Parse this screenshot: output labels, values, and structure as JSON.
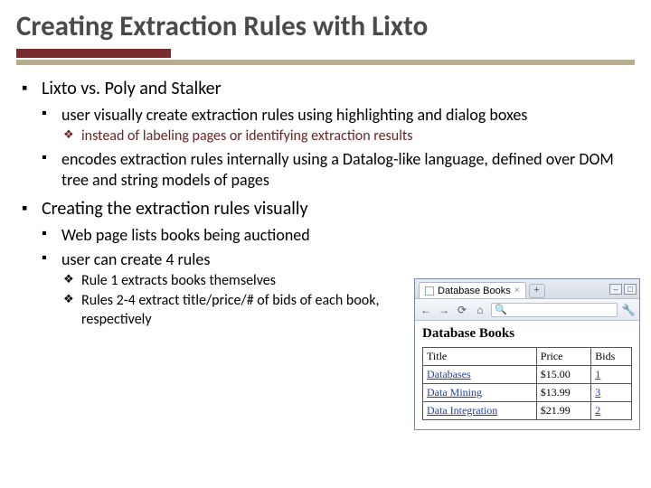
{
  "title": "Creating Extraction Rules with Lixto",
  "sections": [
    {
      "heading": "Lixto vs. Poly and Stalker",
      "items": [
        {
          "text": "user visually create extraction rules using highlighting and dialog boxes",
          "sub": [
            "instead of labeling pages or identifying extraction results"
          ],
          "sub_accent": true
        },
        {
          "text": "encodes extraction rules internally using a Datalog-like language, defined over DOM tree and string models of pages",
          "sub": [],
          "sub_accent": false
        }
      ]
    },
    {
      "heading": "Creating the extraction rules visually",
      "items": [
        {
          "text": "Web page lists books being auctioned",
          "sub": [],
          "sub_accent": false
        },
        {
          "text": "user can create 4 rules",
          "sub": [
            "Rule 1 extracts books themselves",
            "Rules 2-4 extract title/price/# of bids of each book, respectively"
          ],
          "sub_accent": false
        }
      ]
    }
  ],
  "browser": {
    "tab_label": "Database Books",
    "tab_close": "×",
    "new_tab": "+",
    "win_min": "–",
    "win_max": "□",
    "back": "←",
    "fwd": "→",
    "reload": "⟳",
    "home": "⌂",
    "search_icon": "🔍",
    "search_placeholder": "",
    "wrench": "🔧",
    "page_title": "Database Books",
    "table": {
      "headers": [
        "Title",
        "Price",
        "Bids"
      ],
      "rows": [
        {
          "title": "Databases",
          "price": "$15.00",
          "bids": "1"
        },
        {
          "title": "Data Mining",
          "price": "$13.99",
          "bids": "3"
        },
        {
          "title": "Data Integration",
          "price": "$21.99",
          "bids": "2"
        }
      ]
    }
  }
}
